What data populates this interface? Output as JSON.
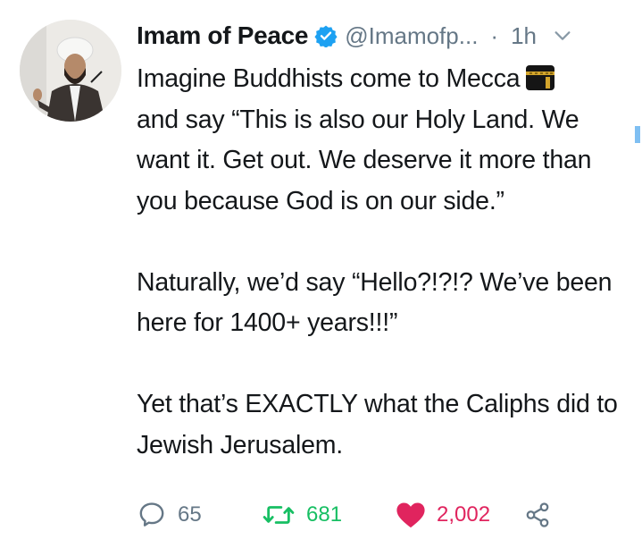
{
  "tweet": {
    "author_name": "Imam of Peace",
    "handle": "@Imamofp...",
    "separator": "·",
    "time": "1h",
    "paragraphs": [
      "Imagine Buddhists come to Mecca",
      "and say “This is also our Holy Land. We want it. Get out. We deserve it more than you because God is on our side.”",
      "Naturally, we’d say “Hello?!?!? We’ve been here for 1400+ years!!!”",
      "Yet that’s EXACTLY what the Caliphs did to Jewish Jerusalem."
    ],
    "icons": {
      "verified": "verified-badge-icon",
      "menu": "chevron-down-icon",
      "emoji": "kaaba-emoji-icon"
    }
  },
  "actions": {
    "replies": "65",
    "retweets": "681",
    "likes": "2,002"
  },
  "colors": {
    "text": "#14171a",
    "secondary": "#657786",
    "verified": "#1da1f2",
    "retweet": "#17bf63",
    "like": "#e0245e"
  }
}
